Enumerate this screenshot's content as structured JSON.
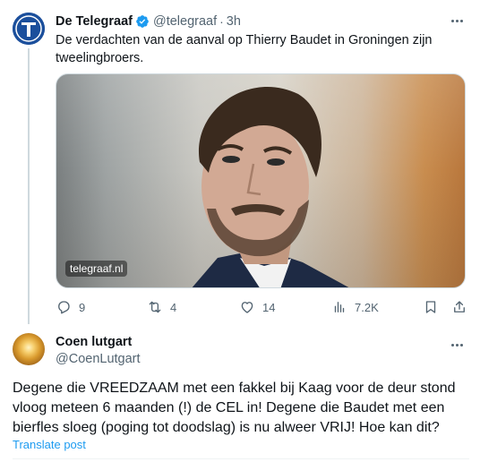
{
  "tweet1": {
    "author_name": "De Telegraaf",
    "handle": "@telegraaf",
    "separator": "·",
    "time": "3h",
    "text": "De verdachten van de aanval op Thierry Baudet in Groningen zijn tweelingbroers.",
    "media_watermark": "telegraaf.nl",
    "actions": {
      "replies": "9",
      "reposts": "4",
      "likes": "14",
      "views": "7.2K"
    }
  },
  "tweet2": {
    "author_name": "Coen lutgart",
    "handle": "@CoenLutgart",
    "text": "Degene die VREEDZAAM met een fakkel bij Kaag voor de deur stond vloog meteen 6 maanden (!) de CEL in! Degene die Baudet met een bierfles sloeg (poging tot doodslag) is nu alweer VRIJ! Hoe kan dit?",
    "translate_label": "Translate post"
  },
  "icons": {
    "verified": "verified-badge-icon",
    "more": "more-options-icon",
    "reply": "reply-icon",
    "repost": "repost-icon",
    "like": "like-icon",
    "views": "views-icon",
    "bookmark": "bookmark-icon",
    "share": "share-icon"
  },
  "colors": {
    "accent": "#1d9bf0",
    "muted_text": "#536471",
    "telegraaf_blue": "#1b4f9c"
  }
}
